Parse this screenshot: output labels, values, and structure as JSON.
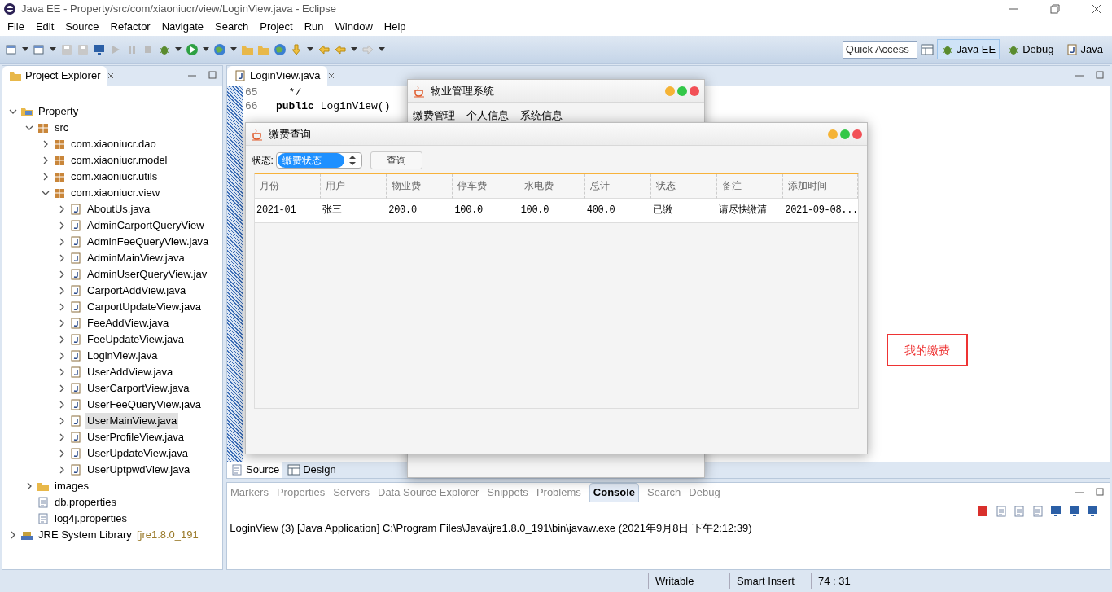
{
  "window": {
    "title": "Java EE - Property/src/com/xiaoniucr/view/LoginView.java - Eclipse"
  },
  "menu": [
    "File",
    "Edit",
    "Source",
    "Refactor",
    "Navigate",
    "Search",
    "Project",
    "Run",
    "Window",
    "Help"
  ],
  "quick_access": {
    "placeholder": "Quick Access"
  },
  "perspectives": [
    {
      "label": "Java EE",
      "selected": true
    },
    {
      "label": "Debug",
      "selected": false
    },
    {
      "label": "Java",
      "selected": false
    }
  ],
  "project_explorer": {
    "title": "Project Explorer",
    "tree": [
      {
        "label": "Property",
        "kind": "project",
        "expanded": true,
        "selected": false,
        "children": [
          {
            "label": "src",
            "kind": "source",
            "expanded": true,
            "selected": false,
            "children": [
              {
                "label": "com.xiaoniucr.dao",
                "kind": "package",
                "expanded": false,
                "selected": false
              },
              {
                "label": "com.xiaoniucr.model",
                "kind": "package",
                "expanded": false,
                "selected": false
              },
              {
                "label": "com.xiaoniucr.utils",
                "kind": "package",
                "expanded": false,
                "selected": false
              },
              {
                "label": "com.xiaoniucr.view",
                "kind": "package",
                "expanded": true,
                "selected": false,
                "children": [
                  {
                    "label": "AboutUs.java",
                    "kind": "java",
                    "expanded": false,
                    "selected": false
                  },
                  {
                    "label": "AdminCarportQueryView",
                    "kind": "java",
                    "expanded": false,
                    "selected": false
                  },
                  {
                    "label": "AdminFeeQueryView.java",
                    "kind": "java",
                    "expanded": false,
                    "selected": false
                  },
                  {
                    "label": "AdminMainView.java",
                    "kind": "java",
                    "expanded": false,
                    "selected": false
                  },
                  {
                    "label": "AdminUserQueryView.jav",
                    "kind": "java",
                    "expanded": false,
                    "selected": false
                  },
                  {
                    "label": "CarportAddView.java",
                    "kind": "java",
                    "expanded": false,
                    "selected": false
                  },
                  {
                    "label": "CarportUpdateView.java",
                    "kind": "java",
                    "expanded": false,
                    "selected": false
                  },
                  {
                    "label": "FeeAddView.java",
                    "kind": "java",
                    "expanded": false,
                    "selected": false
                  },
                  {
                    "label": "FeeUpdateView.java",
                    "kind": "java",
                    "expanded": false,
                    "selected": false
                  },
                  {
                    "label": "LoginView.java",
                    "kind": "java",
                    "expanded": false,
                    "selected": false
                  },
                  {
                    "label": "UserAddView.java",
                    "kind": "java",
                    "expanded": false,
                    "selected": false
                  },
                  {
                    "label": "UserCarportView.java",
                    "kind": "java",
                    "expanded": false,
                    "selected": false
                  },
                  {
                    "label": "UserFeeQueryView.java",
                    "kind": "java",
                    "expanded": false,
                    "selected": false
                  },
                  {
                    "label": "UserMainView.java",
                    "kind": "java",
                    "expanded": false,
                    "selected": true
                  },
                  {
                    "label": "UserProfileView.java",
                    "kind": "java",
                    "expanded": false,
                    "selected": false
                  },
                  {
                    "label": "UserUpdateView.java",
                    "kind": "java",
                    "expanded": false,
                    "selected": false
                  },
                  {
                    "label": "UserUptpwdView.java",
                    "kind": "java",
                    "expanded": false,
                    "selected": false
                  }
                ]
              }
            ]
          },
          {
            "label": "images",
            "kind": "folder",
            "expanded": false,
            "selected": false
          },
          {
            "label": "db.properties",
            "kind": "file",
            "selected": false
          },
          {
            "label": "log4j.properties",
            "kind": "file",
            "selected": false
          }
        ]
      },
      {
        "label": "JRE System Library",
        "suffix": "[jre1.8.0_191",
        "kind": "library",
        "expanded": false,
        "selected": false
      }
    ]
  },
  "editor": {
    "tabs": [
      {
        "label": "LoginView.java",
        "selected": true
      }
    ],
    "lines": [
      {
        "number": "65",
        "code": "  */"
      },
      {
        "number": "66",
        "code": "**public** LoginView()"
      }
    ],
    "bottom_tabs": [
      {
        "label": "Source",
        "selected": true
      },
      {
        "label": "Design",
        "selected": false
      }
    ],
    "floating_label": "我的缴费"
  },
  "main_app": {
    "title": "物业管理系统",
    "menu": [
      "缴费管理",
      "个人信息",
      "系统信息"
    ]
  },
  "fee_query": {
    "title": "缴费查询",
    "filter_label": "状态:",
    "status_select": "缴费状态",
    "query_button": "查询",
    "table": {
      "columns": [
        "月份",
        "用户",
        "物业费",
        "停车费",
        "水电费",
        "总计",
        "状态",
        "备注",
        "添加时间"
      ],
      "rows": [
        [
          "2021-01",
          "张三",
          "200.0",
          "100.0",
          "100.0",
          "400.0",
          "已缴",
          "请尽快缴清",
          "2021-09-08..."
        ]
      ]
    }
  },
  "console": {
    "tabs": [
      {
        "label": "Markers",
        "selected": false
      },
      {
        "label": "Properties",
        "selected": false
      },
      {
        "label": "Servers",
        "selected": false
      },
      {
        "label": "Data Source Explorer",
        "selected": false
      },
      {
        "label": "Snippets",
        "selected": false
      },
      {
        "label": "Problems",
        "selected": false
      },
      {
        "label": "Console",
        "selected": true
      },
      {
        "label": "Search",
        "selected": false
      },
      {
        "label": "Debug",
        "selected": false
      }
    ],
    "output": "LoginView (3) [Java Application] C:\\Program Files\\Java\\jre1.8.0_191\\bin\\javaw.exe (2021年9月8日 下午2:12:39)"
  },
  "status_bar": [
    "Writable",
    "Smart Insert",
    "74 : 31"
  ]
}
